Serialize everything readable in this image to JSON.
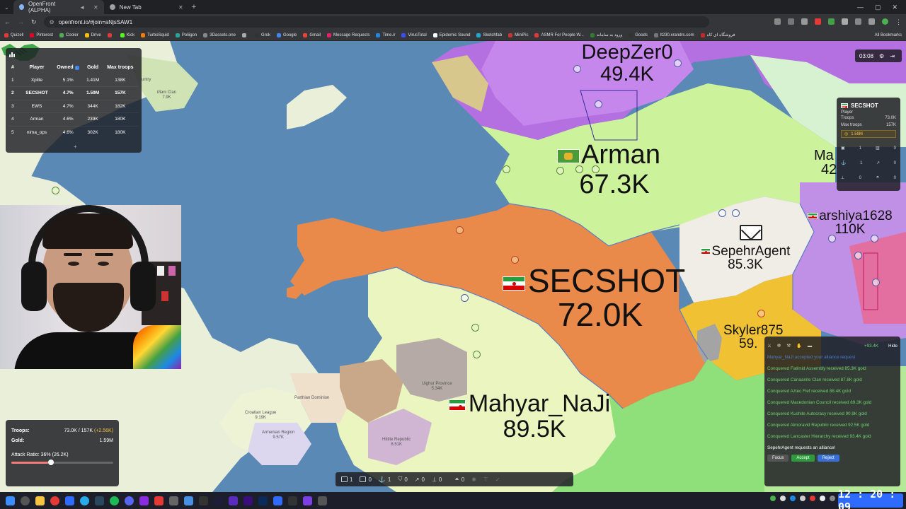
{
  "browser": {
    "tabs": [
      {
        "title": "OpenFront (ALPHA)",
        "active": true
      },
      {
        "title": "New Tab",
        "active": false
      }
    ],
    "url": "openfront.io/#join=aNjsSAW1",
    "bookmarks": [
      "Quizell",
      "Pinterest",
      "Cooler",
      "Drive",
      "",
      "Kick",
      "TurboSquid",
      "Poliigon",
      "3Dassets.one",
      "",
      "Grok",
      "Google",
      "Gmail",
      "Message Requests",
      "Time.ir",
      "VirusTotal",
      "Epidemic Sound",
      "Sketchfab",
      "MiniPic",
      "ASMR For People W...",
      "ورود به سامانه",
      "Goods",
      "lt230.xrandrs.com",
      "فروشگاه ای کاه"
    ],
    "all_bookmarks": "All Bookmarks"
  },
  "leaderboard": {
    "headers": {
      "rank": "#",
      "player": "Player",
      "owned": "Owned",
      "gold": "Gold",
      "troops": "Max troops"
    },
    "sort_badge": "↓",
    "rows": [
      {
        "rank": "1",
        "player": "Xplite",
        "owned": "5.1%",
        "gold": "1.41M",
        "troops": "138K"
      },
      {
        "rank": "2",
        "player": "SECSHOT",
        "owned": "4.7%",
        "gold": "1.59M",
        "troops": "157K"
      },
      {
        "rank": "3",
        "player": "EWS",
        "owned": "4.7%",
        "gold": "344K",
        "troops": "182K"
      },
      {
        "rank": "4",
        "player": "Arman",
        "owned": "4.6%",
        "gold": "239K",
        "troops": "180K"
      },
      {
        "rank": "5",
        "player": "nima_ops",
        "owned": "4.6%",
        "gold": "302K",
        "troops": "180K"
      }
    ],
    "more": "+"
  },
  "map": {
    "players": {
      "deepzero": {
        "name": "DeepZer0",
        "troops": "49.4K"
      },
      "arman": {
        "name": "Arman",
        "troops": "67.3K"
      },
      "secshot": {
        "name": "SECSHOT",
        "troops": "72.0K"
      },
      "mahyar": {
        "name": "Mahyar_NaJi",
        "troops": "89.5K"
      },
      "arshiya": {
        "name": "arshiya1628",
        "troops": "110K"
      },
      "sepehr": {
        "name": "SepehrAgent",
        "troops": "85.3K"
      },
      "skyler": {
        "name": "Skyler875",
        "troops": "59."
      },
      "ma": {
        "name": "Ma",
        "troops": "42"
      }
    },
    "small_labels": {
      "mani": "Mani Clan\n7.9K",
      "untry": "untry",
      "uighur": "Uighur Province\n5.34K",
      "parthian": "Parthian Dominion",
      "croatian": "Croatian League\n9.19K",
      "armenian": "Armenian Region\n9.57K",
      "hittite": "Hittite Republic\n8.51K"
    }
  },
  "controls": {
    "troops_label": "Troops:",
    "troops_value": "73.0K / 157K",
    "troops_gain": "(+2.56K)",
    "gold_label": "Gold:",
    "gold_value": "1.59M",
    "attack_ratio": "Attack Ratio: 36% (26.2K)",
    "attack_ratio_fraction": 0.36
  },
  "timer": {
    "value": "03:08"
  },
  "player_info": {
    "name": "SECSHOT",
    "type": "Player",
    "troops_label": "Troops",
    "troops_value": "73.0K",
    "max_label": "Max troops",
    "max_value": "157K",
    "gold": "1.59M",
    "counts": [
      [
        "1",
        "0"
      ],
      [
        "1",
        "0"
      ],
      [
        "0",
        "0"
      ]
    ]
  },
  "events": {
    "gain": "+93.4K",
    "hide": "Hide",
    "items": [
      {
        "text": "Mahyar_NaJi accepted your alliance request",
        "color": "blue"
      },
      {
        "text": "Conquered Fatimid Assembly received 85.3K gold",
        "color": "green"
      },
      {
        "text": "Conquered Canaanite Clan received 87.8K gold",
        "color": "green"
      },
      {
        "text": "Conquered Aztec Fief received 88.4K gold",
        "color": "green"
      },
      {
        "text": "Conquered Macedonian Council received 89.3K gold",
        "color": "green"
      },
      {
        "text": "Conquered Kushite Autocracy received 90.9K gold",
        "color": "green"
      },
      {
        "text": "Conquered Almoravid Republic received 92.5K gold",
        "color": "green"
      },
      {
        "text": "Conquered Lancaster Hierarchy received 93.4K gold",
        "color": "green"
      }
    ],
    "request": "SepehrAgent requests an alliance!",
    "focus": "Focus",
    "accept": "Accept",
    "reject": "Reject"
  },
  "buildbar": {
    "counts": [
      "1",
      "0",
      "1",
      "0",
      "0",
      "0",
      "0"
    ]
  },
  "clock": "12 : 20 : 09"
}
